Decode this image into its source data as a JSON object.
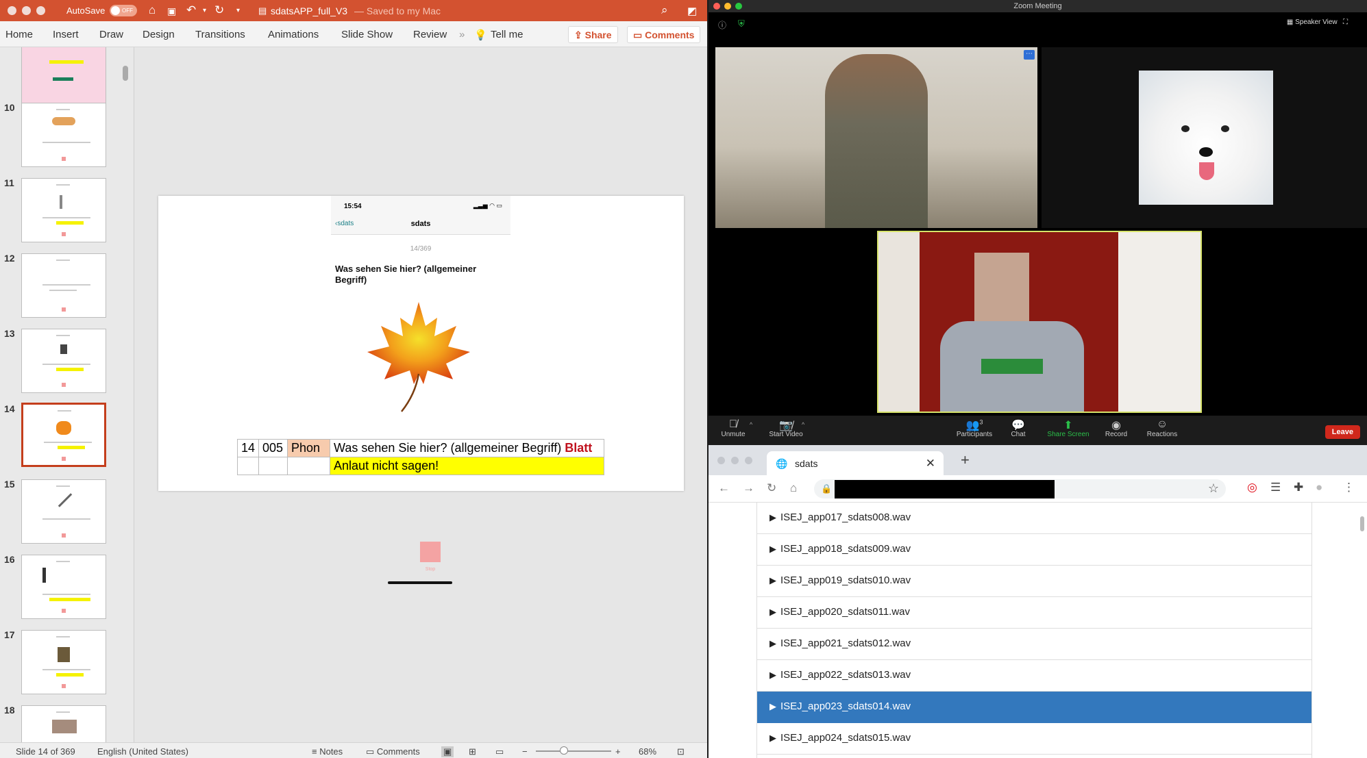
{
  "powerpoint": {
    "autosave_label": "AutoSave",
    "autosave_state": "OFF",
    "doc_title": "sdatsAPP_full_V3",
    "doc_status": "— Saved to my Mac",
    "ribbon_tabs": [
      "Home",
      "Insert",
      "Draw",
      "Design",
      "Transitions",
      "Animations",
      "Slide Show",
      "Review"
    ],
    "tell_me": "Tell me",
    "share": "Share",
    "comments": "Comments",
    "thumbnails": [
      "10",
      "11",
      "12",
      "13",
      "14",
      "15",
      "16",
      "17",
      "18"
    ],
    "active_thumbnail": "14",
    "slide": {
      "phone_time": "15:54",
      "phone_back": "sdats",
      "phone_app": "sdats",
      "counter": "14/369",
      "question": "Was sehen Sie hier? (allgemeiner Begriff)",
      "row_num": "14",
      "row_code": "005",
      "row_phon": "Phon",
      "row_question": "Was sehen Sie hier? (allgemeiner Begriff)",
      "row_answer": "Blatt",
      "row_note": "Anlaut nicht sagen!",
      "stop": "Stop"
    },
    "status": {
      "slide_pos": "Slide 14 of 369",
      "language": "English (United States)",
      "notes": "Notes",
      "comments": "Comments",
      "zoom": "68%"
    }
  },
  "zoom": {
    "title": "Zoom Meeting",
    "speaker_view": "Speaker View",
    "participants_count": "3",
    "toolbar": [
      "Unmute",
      "Start Video",
      "Participants",
      "Chat",
      "Share Screen",
      "Record",
      "Reactions"
    ],
    "leave": "Leave",
    "share_color": "#2bbf4a",
    "leave_color": "#d0281c"
  },
  "chrome": {
    "tab_title": "sdats",
    "files": [
      "ISEJ_app017_sdats008.wav",
      "ISEJ_app018_sdats009.wav",
      "ISEJ_app019_sdats010.wav",
      "ISEJ_app020_sdats011.wav",
      "ISEJ_app021_sdats012.wav",
      "ISEJ_app022_sdats013.wav",
      "ISEJ_app023_sdats014.wav",
      "ISEJ_app024_sdats015.wav"
    ],
    "selected_file": "ISEJ_app023_sdats014.wav",
    "selected_color": "#3378bd"
  }
}
